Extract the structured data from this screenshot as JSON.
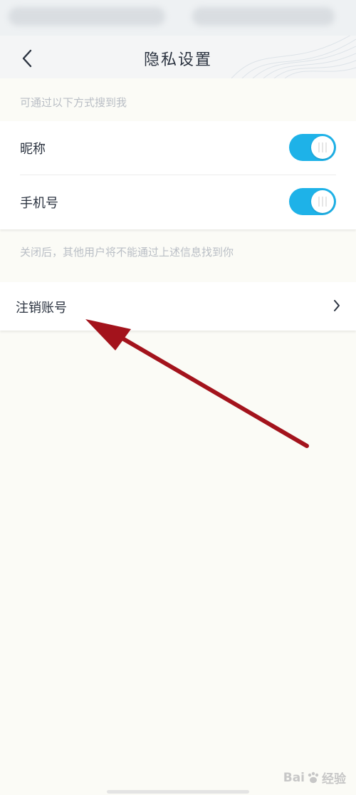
{
  "nav": {
    "title": "隐私设置"
  },
  "search_section": {
    "hint": "可通过以下方式搜到我",
    "items": [
      {
        "label": "昵称",
        "enabled": true
      },
      {
        "label": "手机号",
        "enabled": true
      }
    ],
    "footer": "关闭后，其他用户将不能通过上述信息找到你"
  },
  "account": {
    "logout_label": "注销账号"
  },
  "watermark": {
    "left": "Bai",
    "right": "经验"
  },
  "colors": {
    "toggle_on": "#1eb2e8",
    "annotation_arrow": "#a3131c"
  }
}
